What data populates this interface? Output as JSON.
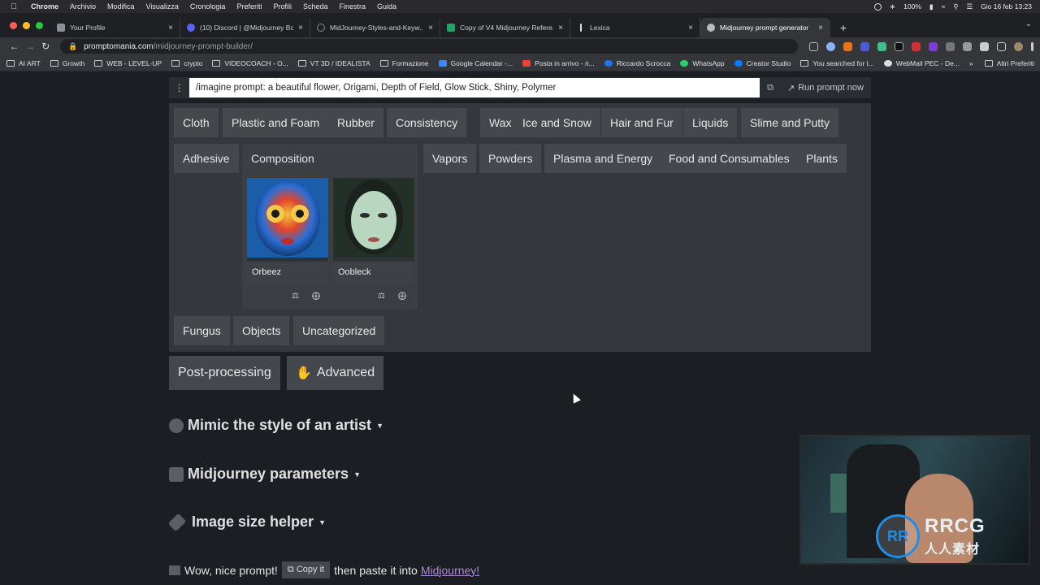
{
  "menubar": {
    "app": "Chrome",
    "items": [
      "Archivio",
      "Modifica",
      "Visualizza",
      "Cronologia",
      "Preferiti",
      "Profili",
      "Scheda",
      "Finestra",
      "Guida"
    ],
    "battery": "100%",
    "datetime": "Gio 16 feb  13:23"
  },
  "tabs": [
    {
      "label": "Your Profile",
      "color": "#8a8f98"
    },
    {
      "label": "(10) Discord | @Midjourney Bot",
      "color": "#5865f2"
    },
    {
      "label": "MidJourney-Styles-and-Keyw...",
      "color": "#dddddd"
    },
    {
      "label": "Copy of V4 Midjourney Refere...",
      "color": "#1fa463"
    },
    {
      "label": "Lexica",
      "color": "#dddddd"
    },
    {
      "label": "Midjourney prompt generator",
      "color": "#bbbbbb",
      "active": true
    }
  ],
  "address": {
    "host": "promptomania.com",
    "path": "/midjourney-prompt-builder/"
  },
  "bookmarks": [
    "AI ART",
    "Growth",
    "WEB - LEVEL-UP",
    "crypto",
    "VIDEOCOACH - O...",
    "VT 3D / IDEALISTA",
    "Formazione",
    "Google Calendar -...",
    "Posta in arrivo - ri...",
    "Riccardo Scrocca",
    "WhatsApp",
    "Creator Studio",
    "You searched for l...",
    "WebMail PEC - De..."
  ],
  "bookmarks_more": "»",
  "bookmarks_other": "Altri Preferiti",
  "prompt": {
    "text": "/imagine prompt: a beautiful flower, Origami, Depth of Field, Glow Stick, Shiny, Polymer",
    "run_label": "Run prompt now"
  },
  "categories_row1": [
    "Cloth",
    "Plastic and Foam",
    "Rubber",
    "Consistency",
    "Wax",
    "Ice and Snow",
    "Hair and Fur",
    "Liquids",
    "Slime and Putty"
  ],
  "categories_row2": [
    "Adhesive",
    "Composition",
    "Vapors",
    "Powders",
    "Plasma and Energy",
    "Food and Consumables",
    "Plants"
  ],
  "categories_row3": [
    "Fungus",
    "Objects",
    "Uncategorized"
  ],
  "cards": [
    {
      "name": "Orbeez"
    },
    {
      "name": "Oobleck"
    }
  ],
  "buttons": {
    "postprocessing": "Post-processing",
    "advanced": "Advanced"
  },
  "sections": {
    "artist": "Mimic the style of an artist",
    "params": "Midjourney parameters",
    "imagesize": "Image size helper"
  },
  "footer": {
    "pre": "Wow, nice prompt!",
    "copy": "Copy it",
    "mid": "then paste it into",
    "link": "Midjourney!"
  },
  "watermark": {
    "letters": "RRCG",
    "sub": "人人素材"
  }
}
